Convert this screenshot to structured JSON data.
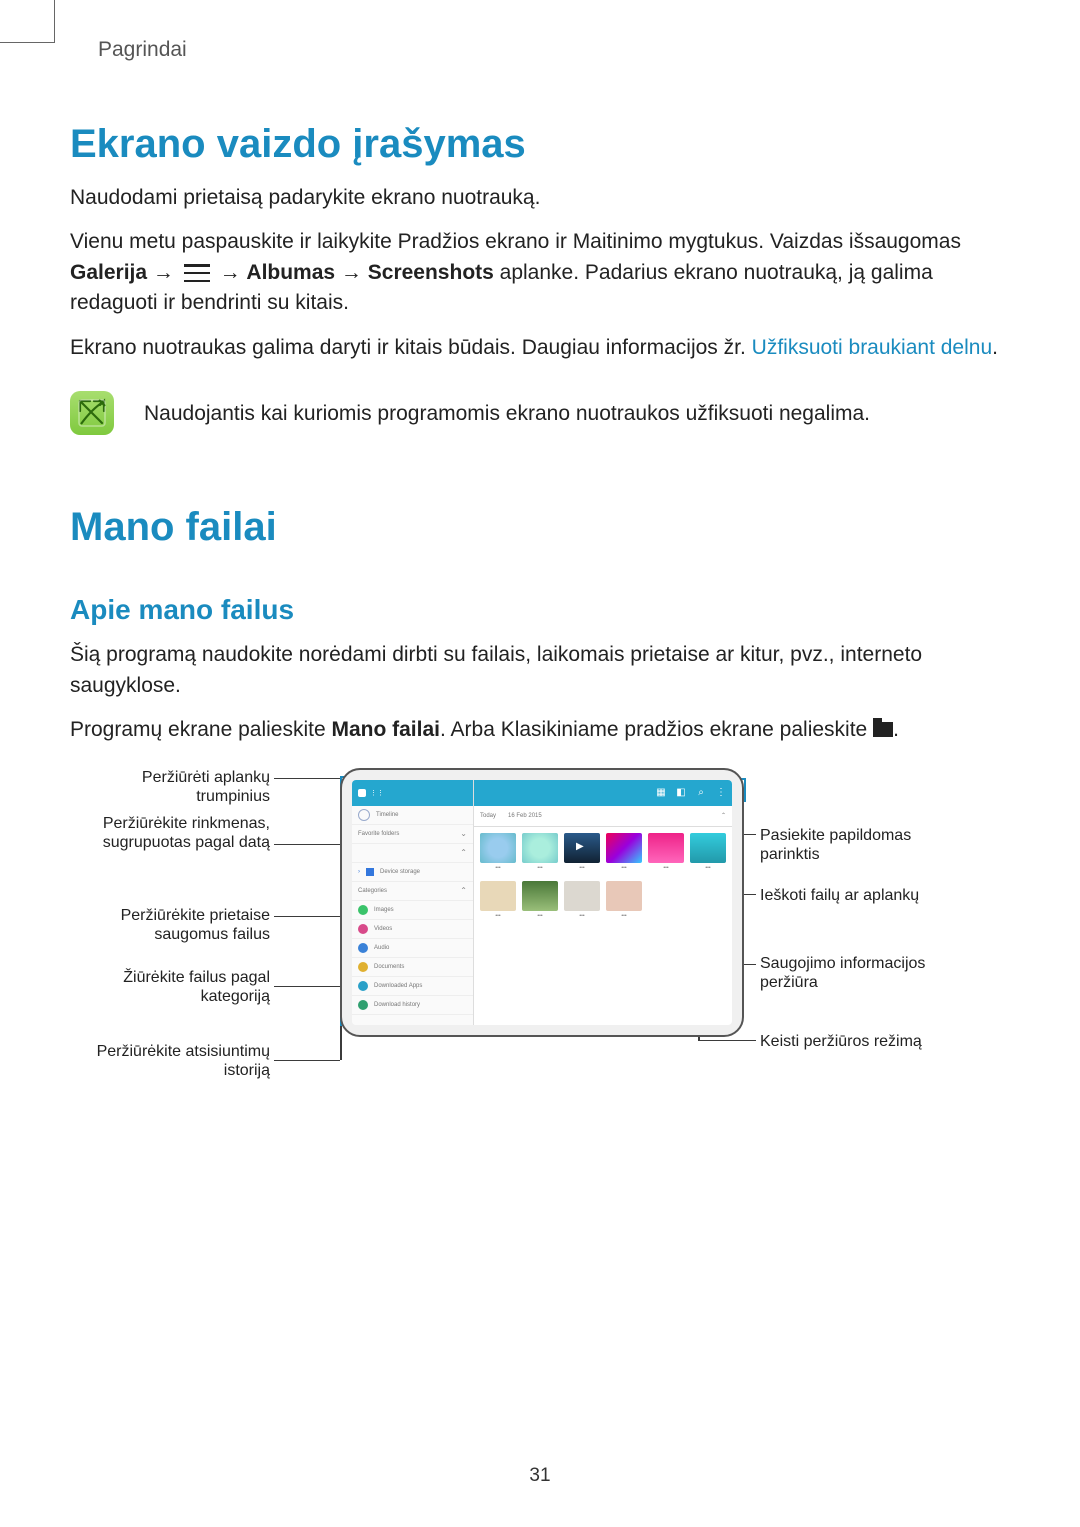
{
  "page": {
    "breadcrumb": "Pagrindai",
    "number": "31"
  },
  "s1": {
    "title": "Ekrano vaizdo įrašymas",
    "p1": "Naudodami prietaisą padarykite ekrano nuotrauką.",
    "p2a": "Vienu metu paspauskite ir laikykite Pradžios ekrano ir Maitinimo mygtukus. Vaizdas išsaugomas ",
    "gal": "Galerija",
    "arrow": " → ",
    "alb": "Albumas",
    "scr": "Screenshots",
    "p2b": " aplanke. Padarius ekrano nuotrauką, ją galima redaguoti ir bendrinti su kitais.",
    "p3a": "Ekrano nuotraukas galima daryti ir kitais būdais. Daugiau informacijos žr. ",
    "link": "Užfiksuoti braukiant delnu",
    "p3b": ".",
    "note": "Naudojantis kai kuriomis programomis ekrano nuotraukos užfiksuoti negalima."
  },
  "s2": {
    "title": "Mano failai",
    "sub": "Apie mano failus",
    "p1": "Šią programą naudokite norėdami dirbti su failais, laikomais prietaise ar kitur, pvz., interneto saugyklose.",
    "p2a": "Programų ekrane palieskite ",
    "mf": "Mano failai",
    "p2b": ". Arba Klasikiniame pradžios ekrane palieskite ",
    "p2c": "."
  },
  "callouts": {
    "l1": "Peržiūrėti aplankų trumpinius",
    "l2": "Peržiūrėkite rinkmenas, sugrupuotas pagal datą",
    "l3": "Peržiūrėkite prietaise saugomus failus",
    "l4": "Žiūrėkite failus pagal kategoriją",
    "l5": "Peržiūrėkite atsisiuntimų istoriją",
    "r1": "Pasiekite papildomas parinktis",
    "r2": "Ieškoti failų ar aplankų",
    "r3": "Saugojimo informacijos peržiūra",
    "r4": "Keisti peržiūros režimą"
  },
  "mock": {
    "timeline": "Timeline",
    "folders": "Favorite folders",
    "device": "Device storage",
    "categories": "Categories",
    "images": "Images",
    "videos": "Videos",
    "audio": "Audio",
    "documents": "Documents",
    "apps": "Downloaded Apps",
    "dlhist": "Download history",
    "today": "Today",
    "date": "16 Feb 2015"
  }
}
